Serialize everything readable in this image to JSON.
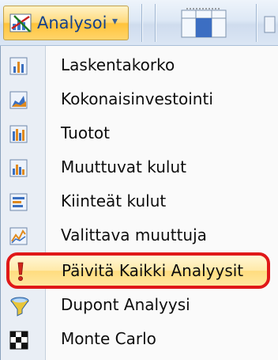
{
  "toolbar": {
    "analysoi_label": "Analysoi",
    "analysoi_icon": "analysis-chart-icon",
    "dropdown_icon": "chevron-down-icon"
  },
  "menu": {
    "items": [
      {
        "label": "Laskentakorko",
        "icon": "bar-chart-icon"
      },
      {
        "label": "Kokonaisinvestointi",
        "icon": "area-chart-icon"
      },
      {
        "label": "Tuotot",
        "icon": "column-chart-icon"
      },
      {
        "label": "Muuttuvat kulut",
        "icon": "column-chart-icon"
      },
      {
        "label": "Kiinteät kulut",
        "icon": "stacked-chart-icon"
      },
      {
        "label": "Valittava muuttuja",
        "icon": "line-chart-icon"
      },
      {
        "label": "Päivitä Kaikki Analyysit",
        "icon": "exclamation-icon"
      },
      {
        "label": "Dupont Analyysi",
        "icon": "funnel-icon"
      },
      {
        "label": "Monte Carlo",
        "icon": "checkered-icon"
      }
    ]
  },
  "colors": {
    "highlight_outline": "#e01818",
    "label_text": "#0d0d0d",
    "button_text": "#15428b"
  }
}
